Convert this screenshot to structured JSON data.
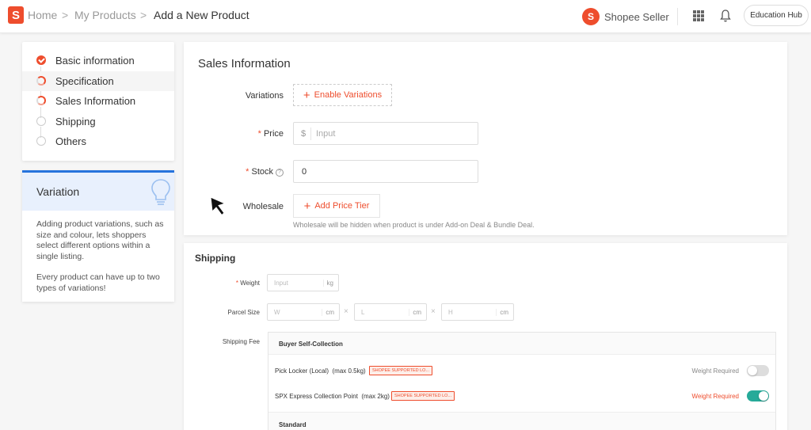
{
  "header": {
    "logo": "S",
    "breadcrumbs": [
      "Home",
      "My Products",
      "Add a New Product"
    ],
    "separator": ">",
    "seller_logo": "S",
    "seller_label": "Shopee Seller",
    "education_hub_label": "Education Hub"
  },
  "steps": [
    {
      "label": "Basic information",
      "state": "done"
    },
    {
      "label": "Specification",
      "state": "partial"
    },
    {
      "label": "Sales Information",
      "state": "partial"
    },
    {
      "label": "Shipping",
      "state": "empty"
    },
    {
      "label": "Others",
      "state": "empty"
    }
  ],
  "tip": {
    "title": "Variation",
    "paragraph1": "Adding product variations, such as size and colour, lets shoppers select different options within a single listing.",
    "paragraph2": "Every product can have up to two types of variations!"
  },
  "sales": {
    "title": "Sales Information",
    "variations_label": "Variations",
    "enable_variations_button": "Enable Variations",
    "price_label": "Price",
    "required_mark": "*",
    "price_currency": "$",
    "price_placeholder": "Input",
    "stock_label": "Stock",
    "stock_help": "?",
    "stock_value": "0",
    "wholesale_label": "Wholesale",
    "add_price_tier_button": "Add Price Tier",
    "wholesale_note": "Wholesale will be hidden when product is under Add-on Deal & Bundle Deal.",
    "plus": "+"
  },
  "shipping": {
    "title": "Shipping",
    "weight_label": "Weight",
    "weight_placeholder": "Input",
    "weight_unit": "kg",
    "parcel_size_label": "Parcel Size",
    "parcel_fields": [
      {
        "placeholder": "W",
        "unit": "cm"
      },
      {
        "placeholder": "L",
        "unit": "cm"
      },
      {
        "placeholder": "H",
        "unit": "cm"
      }
    ],
    "times": "×",
    "shipping_fee_label": "Shipping Fee",
    "fee_group": "Buyer Self-Collection",
    "channels": [
      {
        "name": "Pick Locker (Local)",
        "max": "(max 0.5kg)",
        "badge": "SHOPEE SUPPORTED LO...",
        "weight_required": "Weight Required",
        "enabled": false
      },
      {
        "name": "SPX Express Collection Point",
        "max": "(max 2kg)",
        "badge": "SHOPEE SUPPORTED LO...",
        "weight_required": "Weight Required",
        "enabled": true
      }
    ],
    "standard_group": "Standard"
  },
  "colors": {
    "accent": "#ee4d2d",
    "toggle_on": "#26aa99",
    "tip_border": "#2673dd"
  }
}
